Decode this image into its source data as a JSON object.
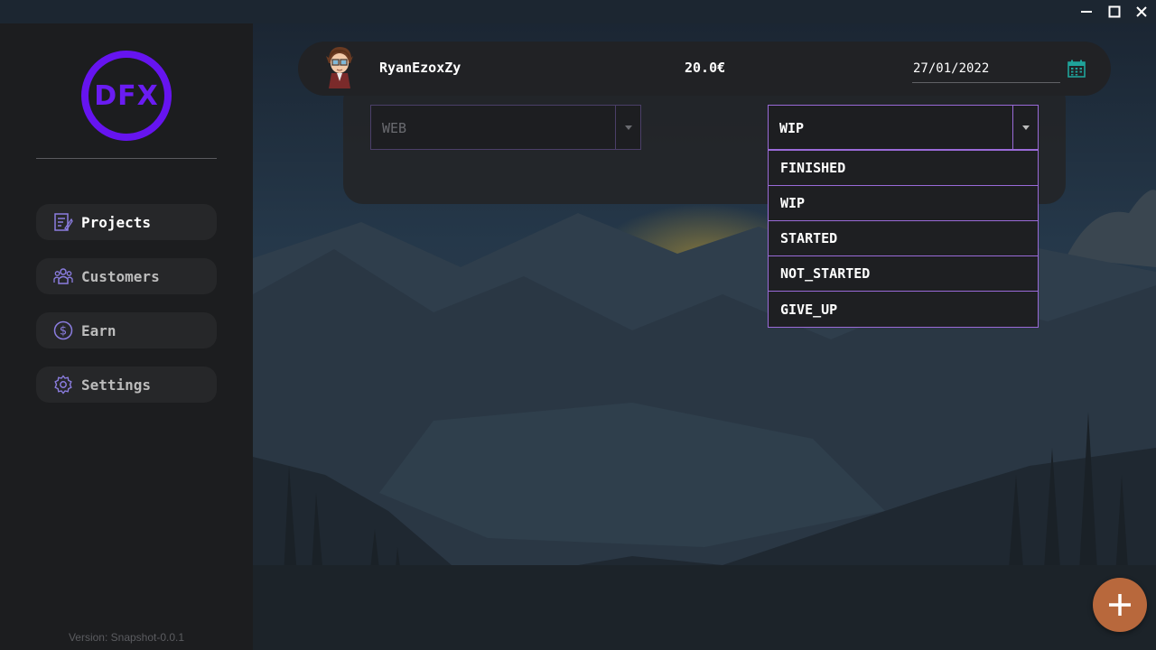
{
  "app": {
    "logo_text": "DFX",
    "version": "Version: Snapshot-0.0.1"
  },
  "sidebar": {
    "items": [
      {
        "label": "Projects",
        "icon": "projects-icon",
        "active": true
      },
      {
        "label": "Customers",
        "icon": "customers-icon",
        "active": false
      },
      {
        "label": "Earn",
        "icon": "dollar-icon",
        "active": false
      },
      {
        "label": "Settings",
        "icon": "gear-icon",
        "active": false
      }
    ]
  },
  "project": {
    "customer": "RyanEzoxZy",
    "price": "20.0€",
    "date": "27/01/2022",
    "type": "WEB",
    "status": "WIP"
  },
  "status_dropdown": {
    "options": [
      "FINISHED",
      "WIP",
      "STARTED",
      "NOT_STARTED",
      "GIVE_UP"
    ]
  },
  "colors": {
    "accent": "#6614f0",
    "dropdown_border": "#9a6ad8",
    "fab": "#b8683c",
    "calendar_icon": "#1fa39a"
  }
}
